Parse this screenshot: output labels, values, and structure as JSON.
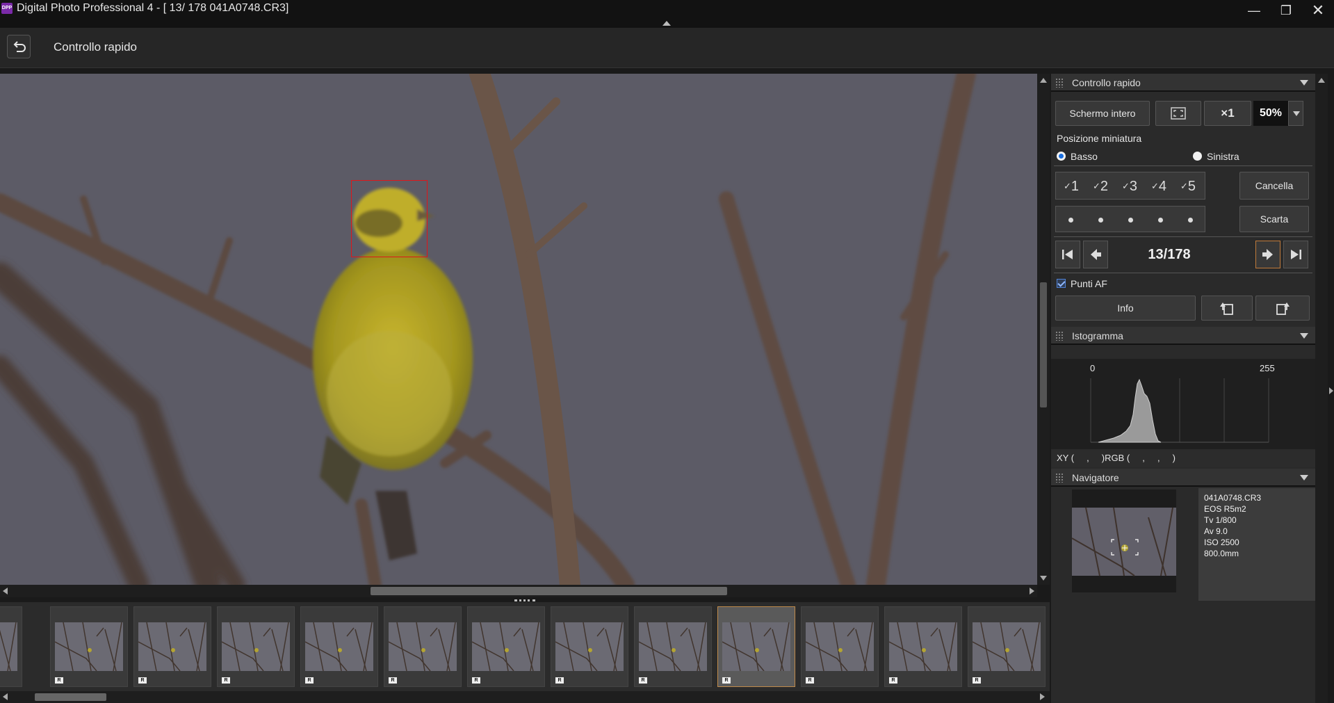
{
  "window": {
    "title": "Digital Photo Professional 4 - [  13/ 178 041A0748.CR3]",
    "app_icon_text": "DPP",
    "minimize": "—",
    "maximize": "❐",
    "close": "✕"
  },
  "toolbar": {
    "mode_title": "Controllo rapido"
  },
  "quick_check": {
    "header": "Controllo rapido",
    "fullscreen_button": "Schermo intero",
    "zoom_x1": "×1",
    "zoom_value": "50%",
    "thumb_position_label": "Posizione miniatura",
    "radio_bottom": "Basso",
    "radio_left": "Sinistra",
    "selected_position": "Basso",
    "ratings": [
      "1",
      "2",
      "3",
      "4",
      "5"
    ],
    "rating_check": "✓",
    "cancel_button": "Cancella",
    "reject_button": "Scarta",
    "image_counter": "13/178",
    "af_points_label": "Punti AF",
    "af_points_checked": true,
    "info_button": "Info"
  },
  "histogram": {
    "header": "Istogramma",
    "min_label": "0",
    "max_label": "255",
    "coords_text": "XY (     ,     )RGB (     ,     ,     )"
  },
  "navigator": {
    "header": "Navigatore",
    "file_name": "041A0748.CR3",
    "camera": "EOS R5m2",
    "shutter": "Tv 1/800",
    "aperture": "Av 9.0",
    "iso": "ISO 2500",
    "focal_length": "800.0mm"
  },
  "filmstrip": {
    "raw_badge": "R",
    "selected_index": 8
  },
  "colors": {
    "photo_background": "#5c5b66",
    "af_point": "#e0161a",
    "selected_thumb_border": "#c08a4a",
    "radio_accent": "#1a6fe0"
  }
}
